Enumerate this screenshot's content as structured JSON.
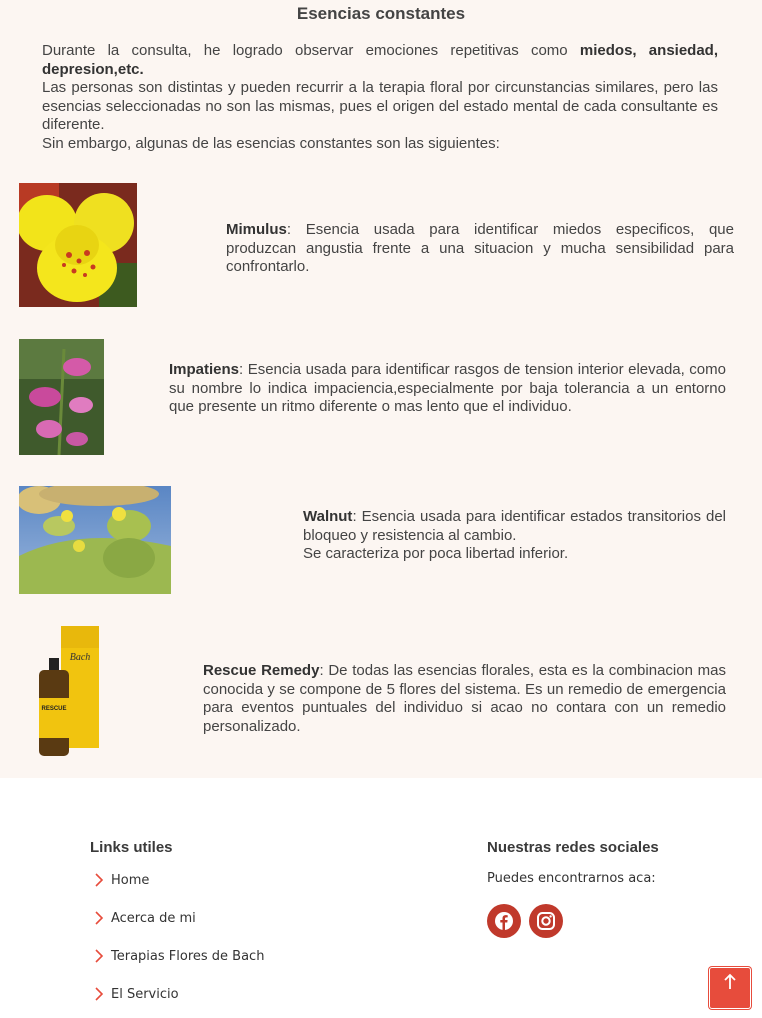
{
  "section": {
    "title": "Esencias constantes",
    "intro": {
      "p1_a": "Durante la consulta, he logrado observar emociones repetitivas como ",
      "p1_b": "miedos, ansiedad, depresion,etc.",
      "p2": "Las personas son distintas y pueden recurrir a la terapia floral por circunstancias similares, pero las esencias seleccionadas no son las mismas, pues el origen del estado mental de cada consultante es diferente.",
      "p3": "Sin embargo, algunas de las esencias constantes son las siguientes:"
    },
    "essences": [
      {
        "name": "Mimulus",
        "sep": ": ",
        "text": "Esencia usada para identificar miedos especificos, que produzcan angustia frente a una situacion y mucha sensibilidad para confrontarlo."
      },
      {
        "name": "Impatiens",
        "sep": ": ",
        "text": "Esencia usada para identificar rasgos de tension interior elevada, como su nombre lo indica impaciencia,especialmente por baja tolerancia a un entorno que presente un ritmo diferente o mas lento que el individuo."
      },
      {
        "name": "Walnut",
        "sep": ": ",
        "text": "Esencia usada para identificar estados transitorios del bloqueo y resistencia al cambio.",
        "text2": "Se caracteriza por poca libertad inferior."
      },
      {
        "name": "Rescue Remedy",
        "sep": ": ",
        "text": "De todas las esencias florales, esta es la combinacion mas conocida y se compone de 5 flores del sistema. Es un remedio de emergencia para eventos puntuales del individuo si acao no contara con un remedio personalizado.",
        "bottle_label_1": "RESCUE",
        "bottle_label_2": "Bach"
      }
    ]
  },
  "footer": {
    "links_title": "Links utiles",
    "links": [
      "Home",
      "Acerca de mi",
      "Terapias Flores de Bach",
      "El Servicio"
    ],
    "social_title": "Nuestras redes sociales",
    "social_subtitle": "Puedes encontrarnos aca:",
    "social_icons": [
      "facebook-icon",
      "instagram-icon"
    ],
    "back_to_top_icon": "arrow-up-icon"
  },
  "colors": {
    "section_bg": "#fcf6f2",
    "social_red": "#c0392b",
    "back_top_red": "#e74c3c"
  }
}
